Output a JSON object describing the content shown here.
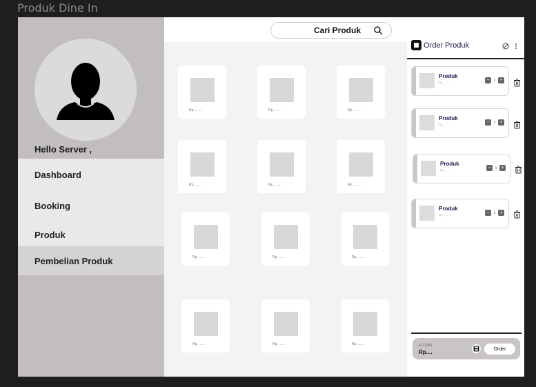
{
  "frame": {
    "title": "Produk Dine In"
  },
  "sidebar": {
    "greeting": "Hello Server ,",
    "items": [
      {
        "label": "Dashboard"
      },
      {
        "label": "Booking"
      },
      {
        "label": "Produk"
      },
      {
        "label": "Pembelian Produk"
      }
    ],
    "active_item": "Pembelian Produk"
  },
  "search": {
    "label": "Cari Produk"
  },
  "products": [
    {
      "price": "Rp. ......."
    },
    {
      "price": "Rp. ......."
    },
    {
      "price": "Rp. ......."
    },
    {
      "price": "Rp. ......."
    },
    {
      "price": "Rp. ......."
    },
    {
      "price": "Rp. ......."
    },
    {
      "price": "Rp. ......."
    },
    {
      "price": "Rp. ......."
    },
    {
      "price": "Rp. ......."
    },
    {
      "price": "Rp. ......."
    },
    {
      "price": "Rp. ......."
    },
    {
      "price": "Rp. ......."
    }
  ],
  "order": {
    "title": "Order Produk",
    "items": [
      {
        "name": "Produk",
        "price": "Rp. .........",
        "qty": "1"
      },
      {
        "name": "Produk",
        "price": "Rp. .........",
        "qty": "1"
      },
      {
        "name": "Produk",
        "price": "Rp. .........",
        "qty": "1"
      },
      {
        "name": "Produk",
        "price": "Rp. .........",
        "qty": "1"
      }
    ],
    "items_count": "4 ITEMS",
    "total": "Rp....",
    "order_button": "Order"
  },
  "colors": {
    "sidebar": "#c2bebe",
    "menu": "#ebe8e8",
    "active_menu": "#d5d2d2",
    "accent_text": "#1a1a4a"
  }
}
